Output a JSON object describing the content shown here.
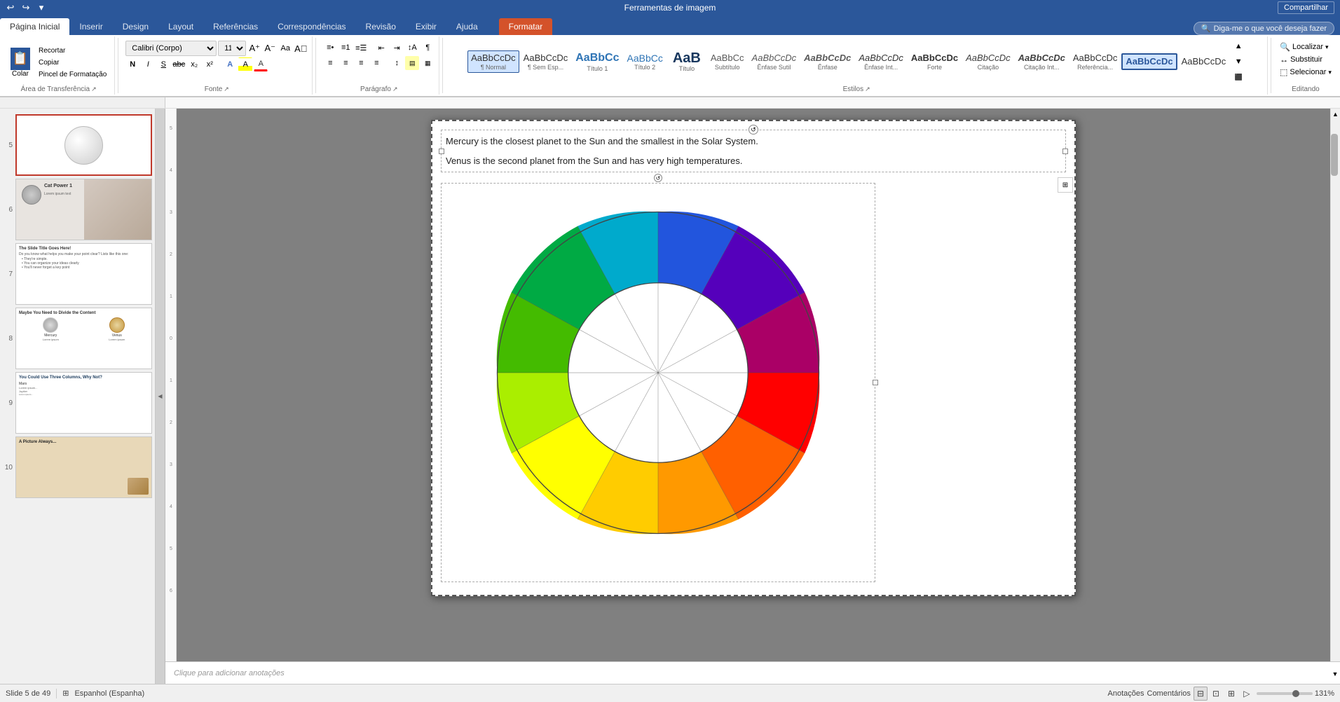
{
  "titlebar": {
    "left_tools": [
      "↩",
      "↪",
      "▾"
    ],
    "center": "Ferramentas de imagem",
    "right": "Compartilhar"
  },
  "tabs": [
    {
      "id": "pagina-inicial",
      "label": "Página Inicial",
      "active": true
    },
    {
      "id": "inserir",
      "label": "Inserir"
    },
    {
      "id": "design",
      "label": "Design"
    },
    {
      "id": "layout",
      "label": "Layout"
    },
    {
      "id": "referencias",
      "label": "Referências"
    },
    {
      "id": "correspondencias",
      "label": "Correspondências"
    },
    {
      "id": "revisao",
      "label": "Revisão"
    },
    {
      "id": "exibir",
      "label": "Exibir"
    },
    {
      "id": "ajuda",
      "label": "Ajuda"
    },
    {
      "id": "formatar",
      "label": "Formatar",
      "format_tab": true
    }
  ],
  "ribbon": {
    "clipboard": {
      "label": "Área de Transferência",
      "colar": "Colar",
      "recortar": "Recortar",
      "copiar": "Copiar",
      "pincel": "Pincel de Formatação"
    },
    "fonte": {
      "label": "Fonte",
      "family": "Calibri (Corpo)",
      "size": "11",
      "bold": "N",
      "italic": "I",
      "underline": "S",
      "strikethrough": "abc",
      "subscript": "x₂",
      "superscript": "x²"
    },
    "paragrafo": {
      "label": "Parágrafo"
    },
    "estilos": {
      "label": "Estilos",
      "items": [
        {
          "id": "normal",
          "preview": "AaBbCcDc",
          "label": "¶ Normal",
          "active": true
        },
        {
          "id": "sem-esp",
          "preview": "AaBbCcDc",
          "label": "¶ Sem Esp..."
        },
        {
          "id": "titulo1",
          "preview": "AaBbCc",
          "label": "Título 1"
        },
        {
          "id": "titulo2",
          "preview": "AaBbCc",
          "label": "Título 2"
        },
        {
          "id": "titulo",
          "preview": "AaB",
          "label": "Título"
        },
        {
          "id": "subtitulo",
          "preview": "AaBbCc",
          "label": "Subtítulo"
        },
        {
          "id": "enfase-sutil",
          "preview": "AaBbCcDc",
          "label": "Ênfase Sutil"
        },
        {
          "id": "enfase",
          "preview": "AaBbCcDc",
          "label": "Ênfase"
        },
        {
          "id": "enfase-int",
          "preview": "AaBbCcDc",
          "label": "Ênfase Int..."
        },
        {
          "id": "forte",
          "preview": "AaBbCcDc",
          "label": "Forte"
        },
        {
          "id": "citacao",
          "preview": "AaBbCcDc",
          "label": "Citação"
        },
        {
          "id": "citacao-int",
          "preview": "AaBbCcDc",
          "label": "Citação Int..."
        },
        {
          "id": "referencia",
          "preview": "AaBbCcDc",
          "label": "Referência..."
        },
        {
          "id": "outro",
          "preview": "AaBbCcDc",
          "label": ""
        }
      ]
    },
    "editando": {
      "label": "Editando",
      "localizar": "Localizar",
      "substituir": "Substituir",
      "selecionar": "Selecionar"
    }
  },
  "search": {
    "placeholder": "Diga-me o que você deseja fazer"
  },
  "slides": [
    {
      "num": "5",
      "active": true,
      "has_circle": true
    },
    {
      "num": "6",
      "active": false,
      "label": "Cat Power 1"
    },
    {
      "num": "7",
      "active": false,
      "label": "The Slide Title Goes Here!"
    },
    {
      "num": "8",
      "active": false,
      "label": "Maybe You Need to Divide the Content"
    },
    {
      "num": "9",
      "active": false,
      "label": "You Could Use Three Columns, Why Not?"
    },
    {
      "num": "10",
      "active": false,
      "label": "A Picture Always..."
    }
  ],
  "slide": {
    "text1": "Mercury is the closest planet to the Sun and the smallest in the Solar System.",
    "text2": "Venus is the second planet from the Sun and has very high temperatures."
  },
  "statusbar": {
    "slide_info": "Slide 5 de 49",
    "language": "Espanhol (Espanha)",
    "notes": "Anotações",
    "comments": "Comentários",
    "zoom": "131%",
    "notes_placeholder": "Clique para adicionar anotações"
  },
  "styles_normal": "1 Normal"
}
